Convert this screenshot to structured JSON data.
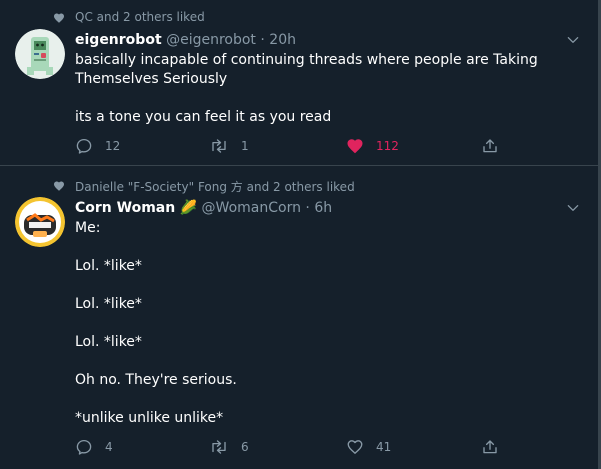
{
  "tweets": [
    {
      "social_context": "QC and 2 others liked",
      "name": "eigenrobot",
      "handle": "@eigenrobot",
      "separator": "·",
      "time": "20h",
      "lines": [
        "basically incapable of continuing threads where people are Taking",
        "Themselves Seriously",
        "its a tone you can feel it as you read"
      ],
      "replies": "12",
      "retweets": "1",
      "likes": "112",
      "liked": true
    },
    {
      "social_context": "Danielle \"F-Society\" Fong 方 and 2 others liked",
      "name": "Corn Woman",
      "emoji": "🌽",
      "handle": "@WomanCorn",
      "separator": "·",
      "time": "6h",
      "lines": [
        "Me:",
        "Lol. *like*",
        "Lol. *like*",
        "Lol. *like*",
        "Oh no. They're serious.",
        "*unlike unlike unlike*"
      ],
      "replies": "4",
      "retweets": "6",
      "likes": "41",
      "liked": false
    }
  ],
  "colors": {
    "background": "#15202b",
    "border": "#38444d",
    "secondary_text": "#8899a6",
    "like": "#e0245e",
    "corn_emoji": "#f5c518"
  },
  "icons": [
    "heart-icon",
    "chevron-down-icon",
    "reply-icon",
    "retweet-icon",
    "like-icon",
    "share-icon"
  ]
}
